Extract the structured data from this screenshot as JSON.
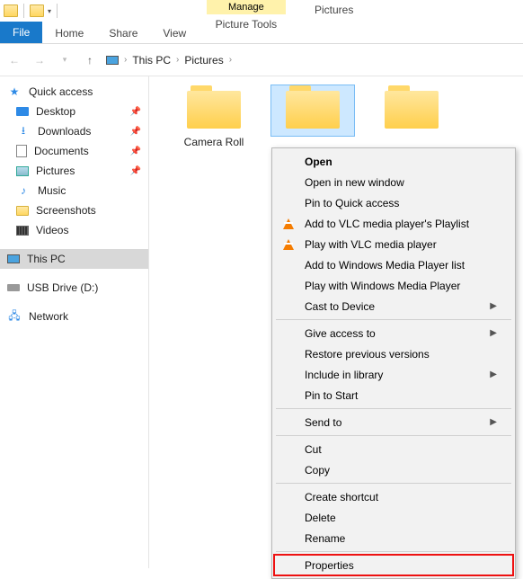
{
  "window": {
    "title": "Pictures"
  },
  "ribbon": {
    "file": "File",
    "tabs": [
      "Home",
      "Share",
      "View"
    ],
    "contextual_group": "Manage",
    "contextual_tab": "Picture Tools"
  },
  "breadcrumb": {
    "root_icon": "pc",
    "items": [
      "This PC",
      "Pictures"
    ]
  },
  "sidebar": {
    "quick_access": "Quick access",
    "items": [
      {
        "label": "Desktop",
        "icon": "desktop",
        "pinned": true
      },
      {
        "label": "Downloads",
        "icon": "download",
        "pinned": true
      },
      {
        "label": "Documents",
        "icon": "doc",
        "pinned": true
      },
      {
        "label": "Pictures",
        "icon": "pic",
        "pinned": true
      },
      {
        "label": "Music",
        "icon": "music",
        "pinned": false
      },
      {
        "label": "Screenshots",
        "icon": "folder-sm",
        "pinned": false
      },
      {
        "label": "Videos",
        "icon": "video",
        "pinned": false
      }
    ],
    "this_pc": "This PC",
    "usb": "USB Drive (D:)",
    "network": "Network"
  },
  "folders": [
    {
      "label": "Camera Roll",
      "selected": false
    },
    {
      "label": "",
      "selected": true
    },
    {
      "label": "",
      "selected": false
    }
  ],
  "context_menu": {
    "items": [
      {
        "label": "Open",
        "bold": true
      },
      {
        "label": "Open in new window"
      },
      {
        "label": "Pin to Quick access"
      },
      {
        "label": "Add to VLC media player's Playlist",
        "icon": "vlc"
      },
      {
        "label": "Play with VLC media player",
        "icon": "vlc"
      },
      {
        "label": "Add to Windows Media Player list"
      },
      {
        "label": "Play with Windows Media Player"
      },
      {
        "label": "Cast to Device",
        "submenu": true
      },
      {
        "sep": true
      },
      {
        "label": "Give access to",
        "submenu": true
      },
      {
        "label": "Restore previous versions"
      },
      {
        "label": "Include in library",
        "submenu": true
      },
      {
        "label": "Pin to Start"
      },
      {
        "sep": true
      },
      {
        "label": "Send to",
        "submenu": true
      },
      {
        "sep": true
      },
      {
        "label": "Cut"
      },
      {
        "label": "Copy"
      },
      {
        "sep": true
      },
      {
        "label": "Create shortcut"
      },
      {
        "label": "Delete"
      },
      {
        "label": "Rename"
      },
      {
        "sep": true
      },
      {
        "label": "Properties",
        "highlight": true
      }
    ]
  }
}
